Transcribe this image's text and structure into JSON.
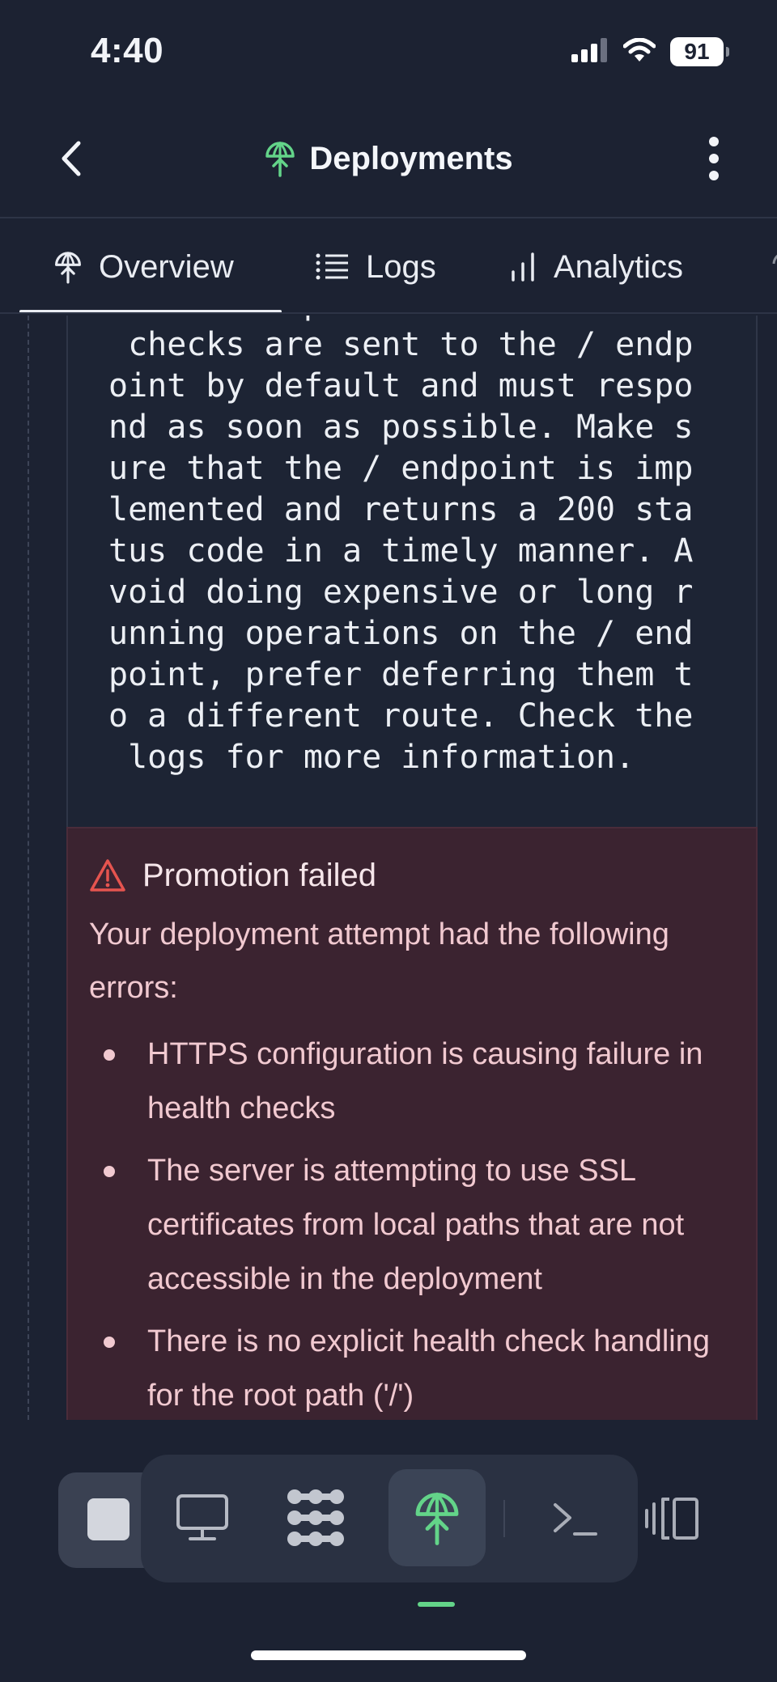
{
  "status_bar": {
    "time": "4:40",
    "battery": "91",
    "icons": [
      "signal-icon",
      "wifi-icon",
      "battery-icon"
    ]
  },
  "header": {
    "title": "Deployments",
    "icon": "deployments-icon",
    "back_icon": "chevron-left-icon",
    "more_icon": "more-vertical-icon"
  },
  "tabs": [
    {
      "label": "Overview",
      "icon": "deployments-icon",
      "active": true
    },
    {
      "label": "Logs",
      "icon": "list-icon",
      "active": false
    },
    {
      "label": "Analytics",
      "icon": "bar-chart-icon",
      "active": false
    }
  ],
  "log": {
    "lines": [
      "oesn't respond in time. Health",
      " checks are sent to the / endp",
      "oint by default and must respo",
      "nd as soon as possible. Make s",
      "ure that the / endpoint is imp",
      "lemented and returns a 200 sta",
      "tus code in a timely manner. A",
      "void doing expensive or long r",
      "unning operations on the / end",
      "point, prefer deferring them t",
      "o a different route. Check the",
      " logs for more information."
    ]
  },
  "error": {
    "icon": "warning-icon",
    "title": "Promotion failed",
    "description": "Your deployment attempt had the following errors:",
    "items": [
      "HTTPS configuration is causing failure in health checks",
      "The server is attempting to use SSL certificates from local paths that are not accessible in the deployment",
      "There is no explicit health check handling for the root path ('/')"
    ]
  },
  "dock": {
    "items": [
      "stop-icon",
      "desktop-icon",
      "grid-icon",
      "deployments-icon",
      "terminal-icon",
      "split-view-icon"
    ],
    "active": "deployments-icon"
  },
  "colors": {
    "background": "#1c2232",
    "accent_green": "#63d489",
    "error_bg": "#3b2330",
    "error_text": "#f1c9d0",
    "warning_red": "#e5544f"
  }
}
